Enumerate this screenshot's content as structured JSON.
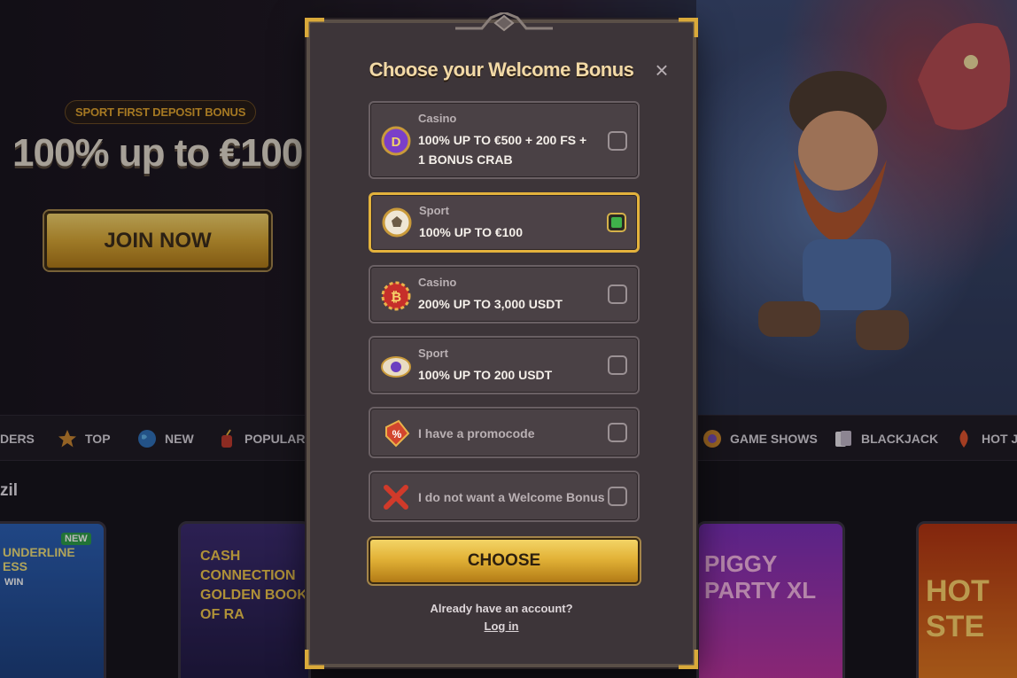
{
  "hero": {
    "badge": "SPORT FIRST DEPOSIT BONUS",
    "amount": "100% up to €100",
    "join_label": "JOIN NOW"
  },
  "nav": {
    "items": [
      {
        "label": "DERS",
        "icon": "leader-icon"
      },
      {
        "label": "TOP",
        "icon": "star-icon"
      },
      {
        "label": "NEW",
        "icon": "globe-icon"
      },
      {
        "label": "POPULAR",
        "icon": "dynamite-icon"
      },
      {
        "label": "GAME SHOWS",
        "icon": "wheel-icon"
      },
      {
        "label": "BLACKJACK",
        "icon": "cards-icon"
      },
      {
        "label": "HOT JA",
        "icon": "fire-icon"
      }
    ]
  },
  "games_section": {
    "title": "zil",
    "cards": [
      {
        "name": "UNDERLINE ESS",
        "badge": "NEW",
        "sub": "WIN"
      },
      {
        "name": "CASH CONNECTION GOLDEN BOOK OF RA"
      },
      {
        "name": "PIGGY PARTY XL"
      },
      {
        "name": "HOT STE"
      }
    ]
  },
  "modal": {
    "title": "Choose your Welcome Bonus",
    "close_label": "×",
    "options": [
      {
        "category": "Casino",
        "text_line1": "100% UP TO €500 + 200 FS +",
        "text_line2": "1 BONUS CRAB",
        "icon": "dice-coin-icon",
        "selected": false
      },
      {
        "category": "Sport",
        "text_line1": "100% UP TO €100",
        "icon": "soccer-ball-icon",
        "selected": true
      },
      {
        "category": "Casino",
        "text_line1": "200% UP TO 3,000 USDT",
        "icon": "bitcoin-chip-icon",
        "selected": false
      },
      {
        "category": "Sport",
        "text_line1": "100% UP TO 200 USDT",
        "icon": "football-bitcoin-icon",
        "selected": false
      }
    ],
    "promo_label": "I have a promocode",
    "no_bonus_label": "I do not want a Welcome Bonus",
    "choose_label": "CHOOSE",
    "account_question": "Already have an account?",
    "login_label": "Log in"
  },
  "colors": {
    "accent_gold": "#e3b23c",
    "modal_bg": "#3d3539",
    "selected_check": "#3fb24a"
  }
}
